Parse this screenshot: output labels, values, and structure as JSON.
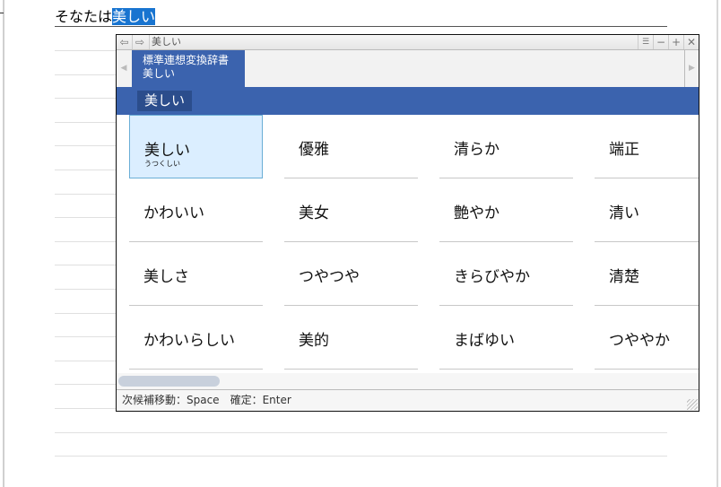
{
  "document": {
    "text_before": "そなたは",
    "selected_text": "美しい"
  },
  "popup": {
    "title": "美しい",
    "tab": {
      "dictionary": "標準連想変換辞書",
      "word": "美しい"
    },
    "query_chip": "美しい",
    "candidates": [
      [
        "美しい",
        "優雅",
        "清らか",
        "端正"
      ],
      [
        "かわいい",
        "美女",
        "艶やか",
        "清い"
      ],
      [
        "美しさ",
        "つやつや",
        "きらびやか",
        "清楚"
      ],
      [
        "かわいらしい",
        "美的",
        "まばゆい",
        "つややか"
      ]
    ],
    "selected_reading": "うつくしい",
    "status": "次候補移動：Space　確定：Enter",
    "scroll_position": 0.0
  },
  "colors": {
    "accent": "#3b63ae",
    "selection": "#1874d0",
    "selected_cell": "#dbeeff"
  }
}
